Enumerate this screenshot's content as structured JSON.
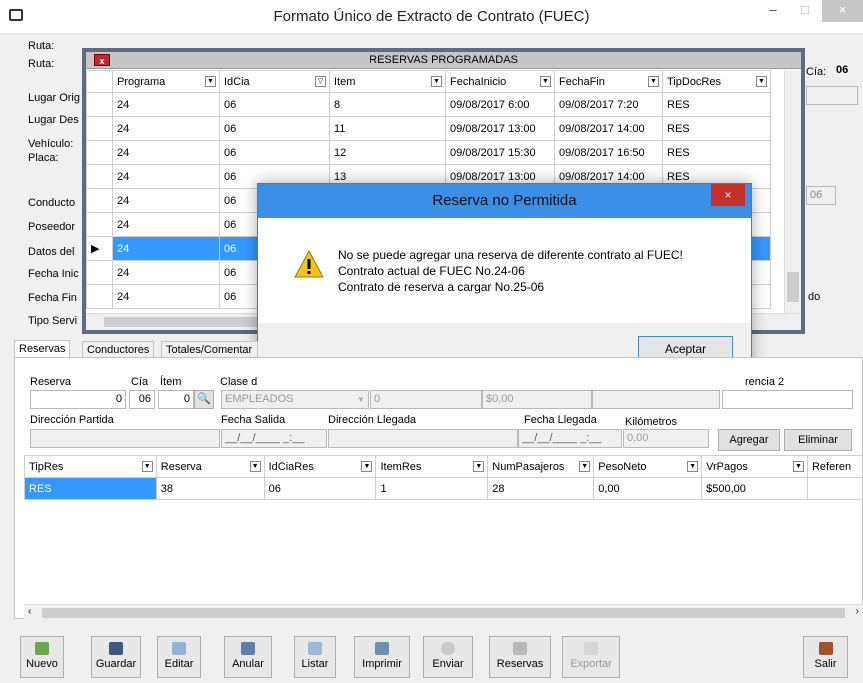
{
  "window": {
    "title": "Formato Único de Extracto de Contrato (FUEC)",
    "min": "–",
    "max": "□",
    "close": "×"
  },
  "form_labels": {
    "ruta1": "Ruta:",
    "ruta2": "Ruta:",
    "lugar_origen": "Lugar Orig",
    "lugar_destino": "Lugar Des",
    "vehiculo": "Vehículo:",
    "placa": "Placa:",
    "conductor": "Conducto",
    "poseedor": "Poseedor",
    "datos": "Datos del",
    "fecha_inicio": "Fecha Inic",
    "fecha_fin": "Fecha Fin",
    "tipo_servicio": "Tipo Servi",
    "cia_label": "Cía:",
    "cia_value": "06",
    "right_gray_value": "06",
    "right_do": "do"
  },
  "popup": {
    "title": "RESERVAS PROGRAMADAS",
    "close": "x",
    "columns": [
      "Programa",
      "IdCia",
      "Item",
      "FechaInicio",
      "FechaFin",
      "TipDocRes"
    ],
    "rows": [
      [
        "24",
        "06",
        "8",
        "09/08/2017 6:00",
        "09/08/2017 7:20",
        "RES"
      ],
      [
        "24",
        "06",
        "11",
        "09/08/2017 13:00",
        "09/08/2017 14:00",
        "RES"
      ],
      [
        "24",
        "06",
        "12",
        "09/08/2017 15:30",
        "09/08/2017 16:50",
        "RES"
      ],
      [
        "24",
        "06",
        "13",
        "09/08/2017 13:00",
        "09/08/2017 14:00",
        "RES"
      ],
      [
        "24",
        "06",
        "",
        "",
        "",
        ""
      ],
      [
        "24",
        "06",
        "",
        "",
        "",
        ""
      ],
      [
        "24",
        "06",
        "",
        "",
        "",
        ""
      ],
      [
        "24",
        "06",
        "",
        "",
        "",
        ""
      ],
      [
        "24",
        "06",
        "",
        "",
        "",
        ""
      ]
    ],
    "selected_row": 6,
    "row_pointer": "▶"
  },
  "dialog": {
    "title": "Reserva no Permitida",
    "close": "×",
    "line1": "No se puede agregar una reserva de diferente contrato al FUEC!",
    "line2": "Contrato actual de FUEC No.24-06",
    "line3": "Contrato de reserva a cargar No.25-06",
    "ok": "Aceptar"
  },
  "tabs": [
    "Reservas",
    "Conductores",
    "Totales/Comentar"
  ],
  "reserva_form": {
    "reserva_label": "Reserva",
    "cia_label": "Cía",
    "item_label": "Ítem",
    "clase_label": "Clase d",
    "reserva_value": "0",
    "cia_value": "06",
    "item_value": "0",
    "clase_value": "EMPLEADOS",
    "clase_num": "0",
    "valor": "$0,00",
    "referencia2_label": "rencia 2",
    "direccion_partida_label": "Dirección Partida",
    "fecha_salida_label": "Fecha Salida",
    "direccion_llegada_label": "Dirección Llegada",
    "fecha_llegada_label": "Fecha Llegada",
    "kilometros_label": "Kilómetros",
    "kilometros_value": "0,00",
    "fecha_salida_mask": "__/__/____ _:__",
    "fecha_llegada_mask": "__/__/____ _:__",
    "agregar": "Agregar",
    "eliminar": "Eliminar"
  },
  "res_table": {
    "columns": [
      "TipRes",
      "Reserva",
      "IdCiaRes",
      "ItemRes",
      "NumPasajeros",
      "PesoNeto",
      "VrPagos",
      "Referen"
    ],
    "rows": [
      [
        "RES",
        "38",
        "06",
        "1",
        "28",
        "0,00",
        "$500,00",
        ""
      ]
    ]
  },
  "toolbar": {
    "nuevo": "Nuevo",
    "guardar": "Guardar",
    "editar": "Editar",
    "anular": "Anular",
    "listar": "Listar",
    "imprimir": "Imprimir",
    "enviar": "Enviar",
    "reservas": "Reservas",
    "exportar": "Exportar",
    "salir": "Salir"
  },
  "colors": {
    "selection": "#3399ff",
    "dialog_title": "#3c8fe6",
    "close_red": "#c7312c",
    "popup_border": "#5e6b80"
  }
}
